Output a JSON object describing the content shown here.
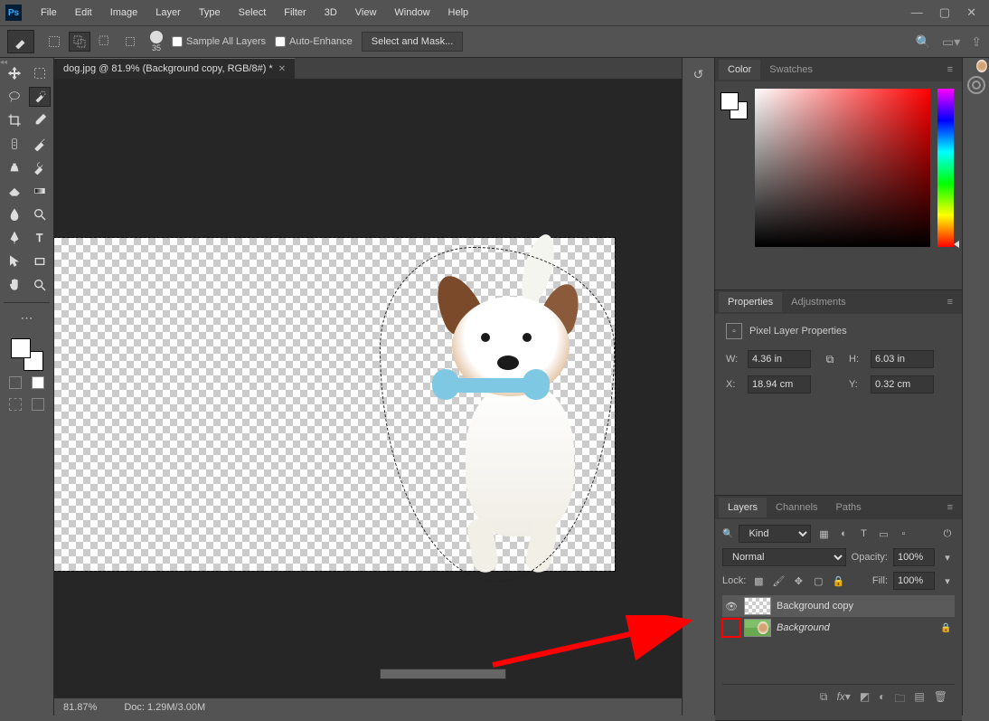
{
  "menubar": {
    "logo": "Ps",
    "items": [
      "File",
      "Edit",
      "Image",
      "Layer",
      "Type",
      "Select",
      "Filter",
      "3D",
      "View",
      "Window",
      "Help"
    ],
    "win": {
      "min": "—",
      "max": "▢",
      "close": "✕"
    }
  },
  "options": {
    "brush_size": "35",
    "sample_all": "Sample All Layers",
    "auto_enhance": "Auto-Enhance",
    "select_mask": "Select and Mask..."
  },
  "document": {
    "tab_title": "dog.jpg @ 81.9% (Background copy, RGB/8#) *"
  },
  "status": {
    "zoom": "81.87%",
    "doc": "Doc: 1.29M/3.00M"
  },
  "panels": {
    "color": {
      "tabs": [
        "Color",
        "Swatches"
      ],
      "active": 0
    },
    "properties": {
      "tabs": [
        "Properties",
        "Adjustments"
      ],
      "active": 0,
      "title": "Pixel Layer Properties",
      "w_label": "W:",
      "w": "4.36 in",
      "h_label": "H:",
      "h": "6.03 in",
      "x_label": "X:",
      "x": "18.94 cm",
      "y_label": "Y:",
      "y": "0.32 cm"
    },
    "layers": {
      "tabs": [
        "Layers",
        "Channels",
        "Paths"
      ],
      "active": 0,
      "filter_kind": "Kind",
      "blend_mode": "Normal",
      "opacity_label": "Opacity:",
      "opacity": "100%",
      "lock_label": "Lock:",
      "fill_label": "Fill:",
      "fill": "100%",
      "items": [
        {
          "name": "Background copy",
          "visible": true,
          "selected": true,
          "locked": false
        },
        {
          "name": "Background",
          "visible": false,
          "selected": false,
          "locked": true,
          "italic": true
        }
      ]
    }
  }
}
